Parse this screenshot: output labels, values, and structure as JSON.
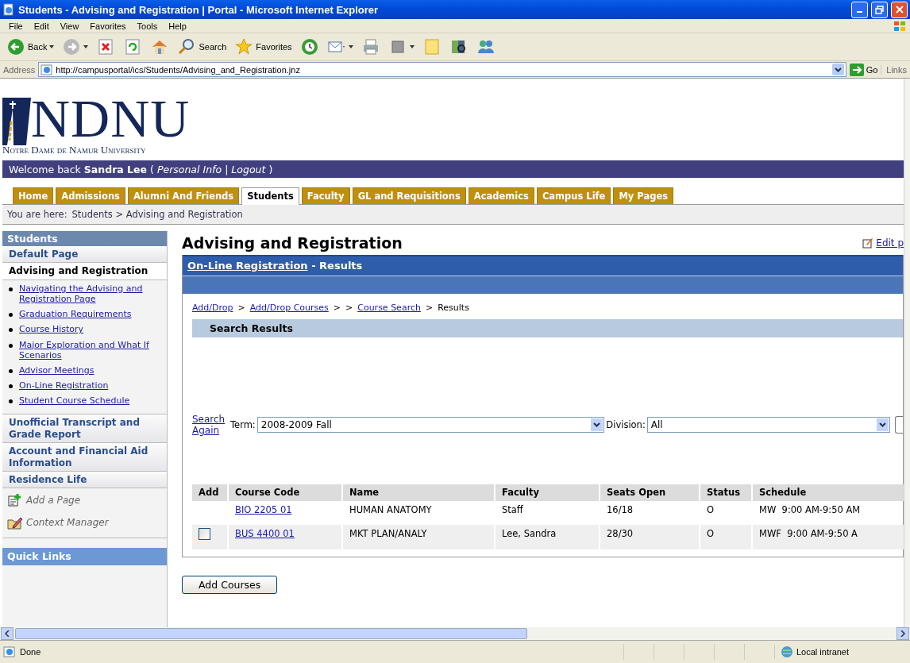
{
  "window": {
    "title": "Students - Advising and Registration | Portal - Microsoft Internet Explorer"
  },
  "menu": [
    "File",
    "Edit",
    "View",
    "Favorites",
    "Tools",
    "Help"
  ],
  "toolbar": [
    {
      "kind": "back",
      "label": "Back"
    },
    {
      "kind": "forward"
    },
    {
      "kind": "stop"
    },
    {
      "kind": "refresh"
    },
    {
      "kind": "home"
    },
    {
      "kind": "search",
      "label": "Search"
    },
    {
      "kind": "favorites",
      "label": "Favorites"
    },
    {
      "kind": "history"
    },
    {
      "kind": "mail"
    },
    {
      "kind": "print"
    },
    {
      "kind": "edit"
    },
    {
      "kind": "note"
    },
    {
      "kind": "research"
    },
    {
      "kind": "messenger"
    }
  ],
  "address_bar": {
    "label": "Address",
    "url": "http://campusportal/ics/Students/Advising_and_Registration.jnz",
    "go": "Go",
    "links": "Links"
  },
  "site": {
    "logo": "NDNU",
    "university": "Notre Dame de Namur University",
    "greeting": "Welcome back",
    "user": "Sandra Lee",
    "open": "(",
    "links": [
      "Personal Info",
      "Logout"
    ],
    "separator": "|",
    "close": ")"
  },
  "tabs": [
    {
      "label": "Home",
      "selected": false
    },
    {
      "label": "Admissions",
      "selected": false
    },
    {
      "label": "Alumni And Friends",
      "selected": false
    },
    {
      "label": "Students",
      "selected": true
    },
    {
      "label": "Faculty",
      "selected": false
    },
    {
      "label": "GL and Requisitions",
      "selected": false
    },
    {
      "label": "Academics",
      "selected": false
    },
    {
      "label": "Campus Life",
      "selected": false
    },
    {
      "label": "My Pages",
      "selected": false
    }
  ],
  "breadcrumb": {
    "label": "You are here:",
    "path": "Students > Advising and Registration"
  },
  "sidebar": {
    "title": "Students",
    "items": [
      {
        "label": "Default Page",
        "selected": false
      },
      {
        "label": "Advising and Registration",
        "selected": true,
        "children": [
          "Navigating the Advising and Registration Page",
          "Graduation Requirements",
          "Course History",
          "Major Exploration and What If Scenarios",
          "Advisor Meetings",
          "On-Line Registration",
          "Student Course Schedule"
        ]
      },
      {
        "label": "Unofficial Transcript and Grade Report",
        "selected": false
      },
      {
        "label": "Account and Financial Aid Information",
        "selected": false
      },
      {
        "label": "Residence Life",
        "selected": false
      }
    ],
    "tools": [
      {
        "kind": "add",
        "label": "Add a Page"
      },
      {
        "kind": "context",
        "label": "Context Manager"
      }
    ],
    "quick_links": "Quick Links"
  },
  "main": {
    "title": "Advising and Registration",
    "edit_link": "Edit p",
    "portlet": {
      "link": "On-Line Registration",
      "suffix": "- Results"
    },
    "crumbs": [
      {
        "kind": "link",
        "label": "Add/Drop"
      },
      {
        "kind": "text",
        "label": ">"
      },
      {
        "kind": "link",
        "label": "Add/Drop Courses"
      },
      {
        "kind": "text",
        "label": ">"
      },
      {
        "kind": "text",
        "label": ">"
      },
      {
        "kind": "link",
        "label": "Course Search"
      },
      {
        "kind": "text",
        "label": ">"
      },
      {
        "kind": "text",
        "label": "Results"
      }
    ],
    "section_title": "Search Results",
    "search_again": "Search Again",
    "filters": [
      {
        "label": "Term:",
        "value": "2008-2009 Fall"
      },
      {
        "label": "Division:",
        "value": "All"
      }
    ],
    "table": {
      "columns": [
        "Add",
        "Course Code",
        "Name",
        "Faculty",
        "Seats Open",
        "Status",
        "Schedule"
      ],
      "rows": [
        {
          "checkbox": false,
          "code": "BIO 2205 01",
          "name": "HUMAN ANATOMY",
          "faculty": "Staff",
          "seats": "16/18",
          "status": "O",
          "schedule": "MW  9:00 AM-9:50 AM"
        },
        {
          "checkbox": true,
          "checked": false,
          "code": "BUS 4400 01",
          "name": "MKT PLAN/ANALY",
          "faculty": "Lee, Sandra",
          "seats": "28/30",
          "status": "O",
          "schedule": "MWF  9:00 AM-9:50 A"
        }
      ]
    },
    "add_button": "Add Courses"
  },
  "status_bar": {
    "text": "Done",
    "zone": "Local intranet"
  }
}
